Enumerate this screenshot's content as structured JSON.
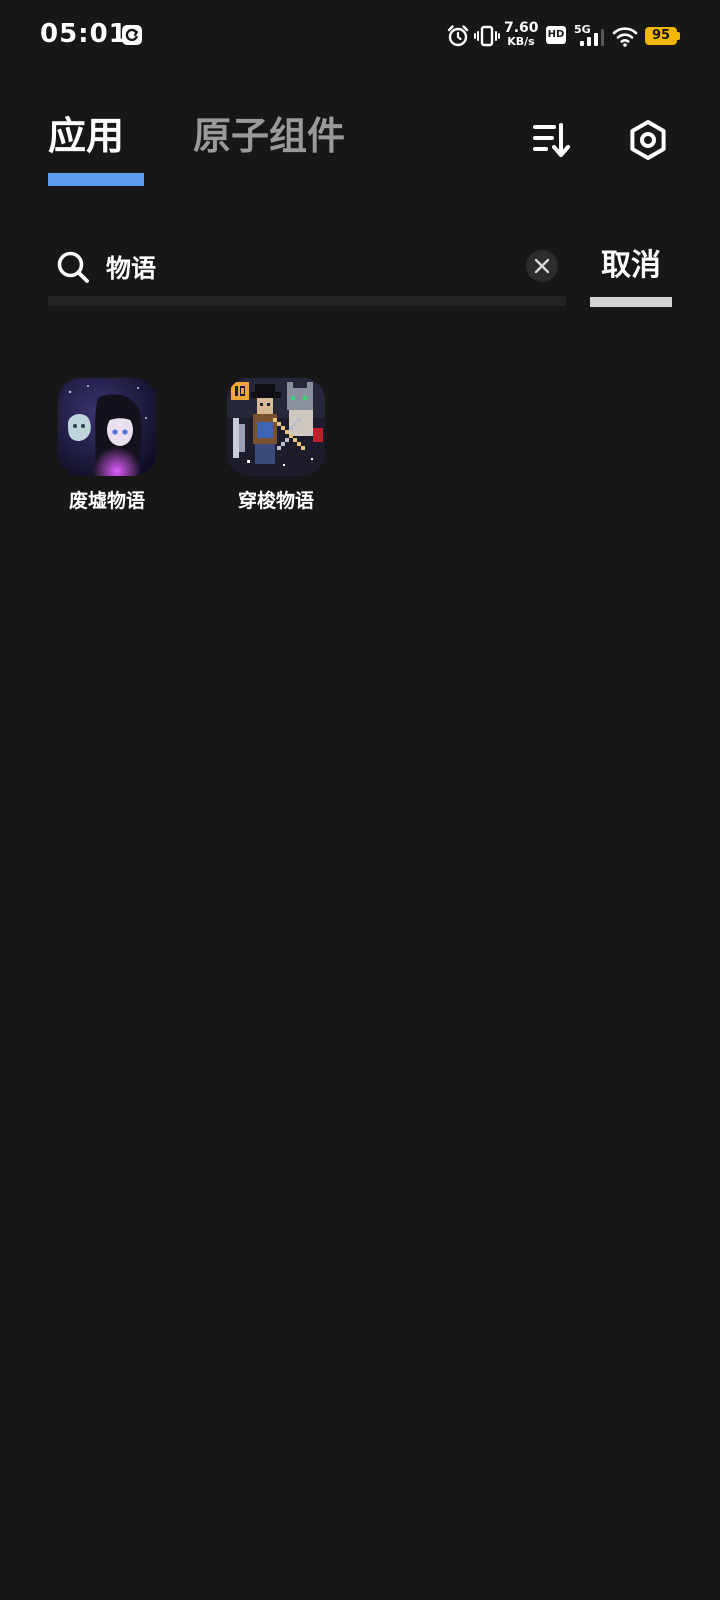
{
  "status_bar": {
    "time": "05:01",
    "network_speed_value": "7.60",
    "network_speed_unit": "KB/s",
    "hd_label": "HD",
    "network_type": "5G",
    "battery_level": "95",
    "battery_color": "#f2b705",
    "icons": [
      "sync-icon",
      "alarm-icon",
      "vibrate-icon",
      "signal-icon",
      "wifi-icon",
      "battery-icon"
    ]
  },
  "header": {
    "tabs": [
      {
        "label": "应用",
        "active": true
      },
      {
        "label": "原子组件",
        "active": false
      }
    ],
    "active_color": "#5b9cf0",
    "actions": [
      "sort-icon",
      "settings-icon"
    ]
  },
  "search": {
    "query": "物语",
    "cancel_label": "取消"
  },
  "results": [
    {
      "name": "废墟物语"
    },
    {
      "name": "穿梭物语"
    }
  ]
}
